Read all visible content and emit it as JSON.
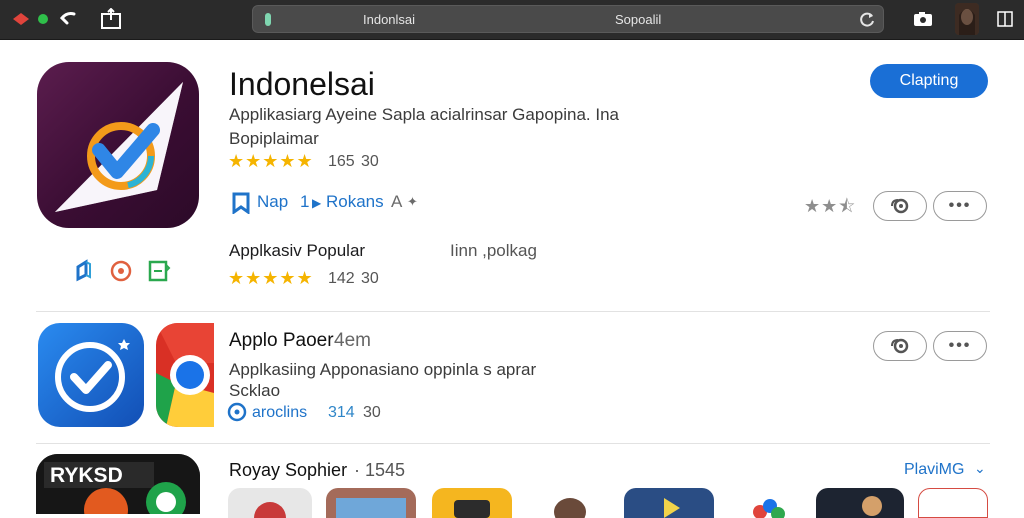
{
  "topbar": {
    "address_left": "Indonlsai",
    "address_right": "Sopoalil",
    "icons": [
      "diamond-red-icon",
      "green-dot-icon",
      "back-icon",
      "share-icon",
      "reload-icon",
      "camera-icon",
      "user-avatar",
      "tab-icon"
    ]
  },
  "featured": {
    "title": "Indonelsai",
    "description_1": "Applikasiarg Ayeine Sapla acialrinsar Gapopina. Ina",
    "description_2": "Bopiplaimar",
    "rating_count": "165",
    "rating_value": "30",
    "get_label": "Clapting",
    "links": {
      "nap": "Nap",
      "one": "1",
      "rokans": "Rokans",
      "a": "A"
    },
    "icons": [
      "app-icon-checkmark",
      "link-icon",
      "refresh-circle-icon",
      "document-icon"
    ]
  },
  "popular": {
    "label": "Applkasiv Popular",
    "side_text": "Iinn ,polkag",
    "rating_count": "142",
    "rating_value": "30"
  },
  "apple_paper": {
    "title": "Applo Paoer",
    "title_suffix": "4em",
    "description_1": "Applkasiing Apponasiano oppinla s aprar",
    "description_2": "Scklao",
    "link_label": "aroclins",
    "count": "314",
    "count_2": "30"
  },
  "royal": {
    "title": "Royay Sophier",
    "title_suffix": "· 1545",
    "see_all": "PlaviMG",
    "tile_text": "RYKSD"
  },
  "colors": {
    "accent": "#1a6fd6",
    "star": "#f5b400",
    "link": "#1f73c9",
    "topbar": "#2b2b2b"
  }
}
